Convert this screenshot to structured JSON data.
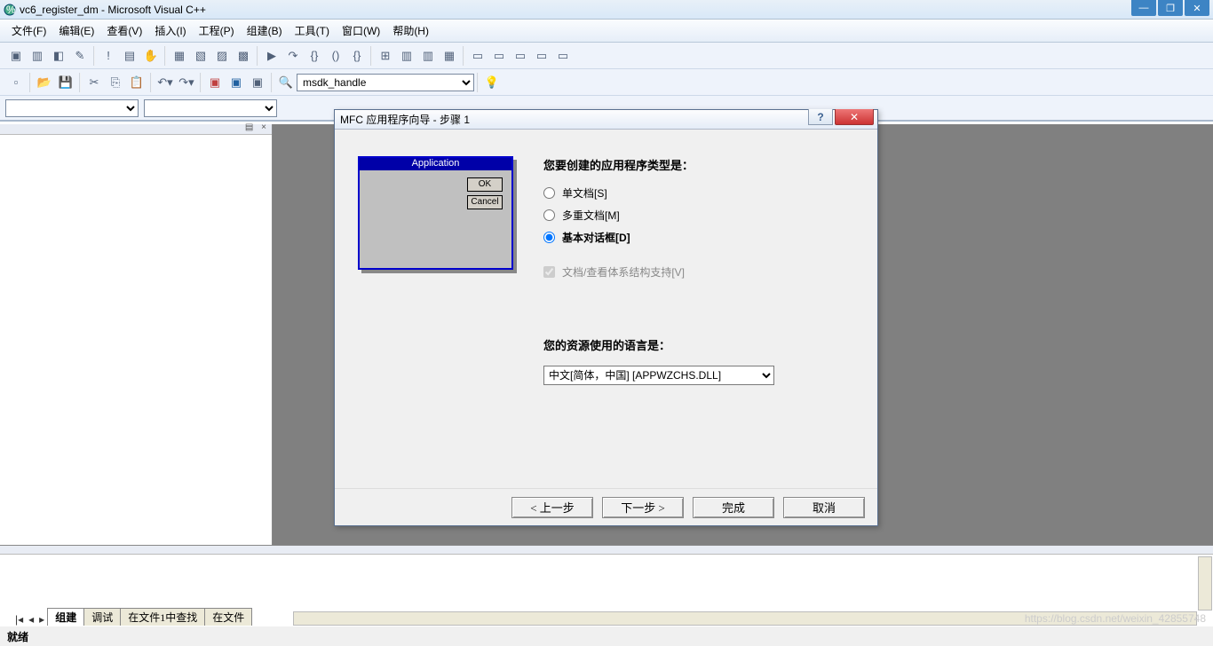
{
  "window": {
    "title": "vc6_register_dm - Microsoft Visual C++"
  },
  "menu": {
    "file": "文件(F)",
    "edit": "编辑(E)",
    "view": "查看(V)",
    "insert": "插入(I)",
    "project": "工程(P)",
    "build": "组建(B)",
    "tools": "工具(T)",
    "window": "窗口(W)",
    "help": "帮助(H)"
  },
  "combo": {
    "wizbar": "msdk_handle"
  },
  "output_tabs": {
    "t1": "组建",
    "t2": "调试",
    "t3": "在文件1中查找",
    "t4": "在文件"
  },
  "status": "就绪",
  "dialog": {
    "title": "MFC 应用程序向导 - 步骤 1",
    "help": "?",
    "close": "✕",
    "preview_title": "Application",
    "preview_ok": "OK",
    "preview_cancel": "Cancel",
    "q1": "您要创建的应用程序类型是：",
    "opt_single": "单文档[S]",
    "opt_multiple": "多重文档[M]",
    "opt_dialog": "基本对话框[D]",
    "check_docview": "文档/查看体系结构支持[V]",
    "q2": "您的资源使用的语言是：",
    "lang_value": "中文[简体，中国] [APPWZCHS.DLL]",
    "btn_back": "< 上一步",
    "btn_next": "下一步 >",
    "btn_finish": "完成",
    "btn_cancel": "取消"
  },
  "watermark": "https://blog.csdn.net/weixin_42855748"
}
